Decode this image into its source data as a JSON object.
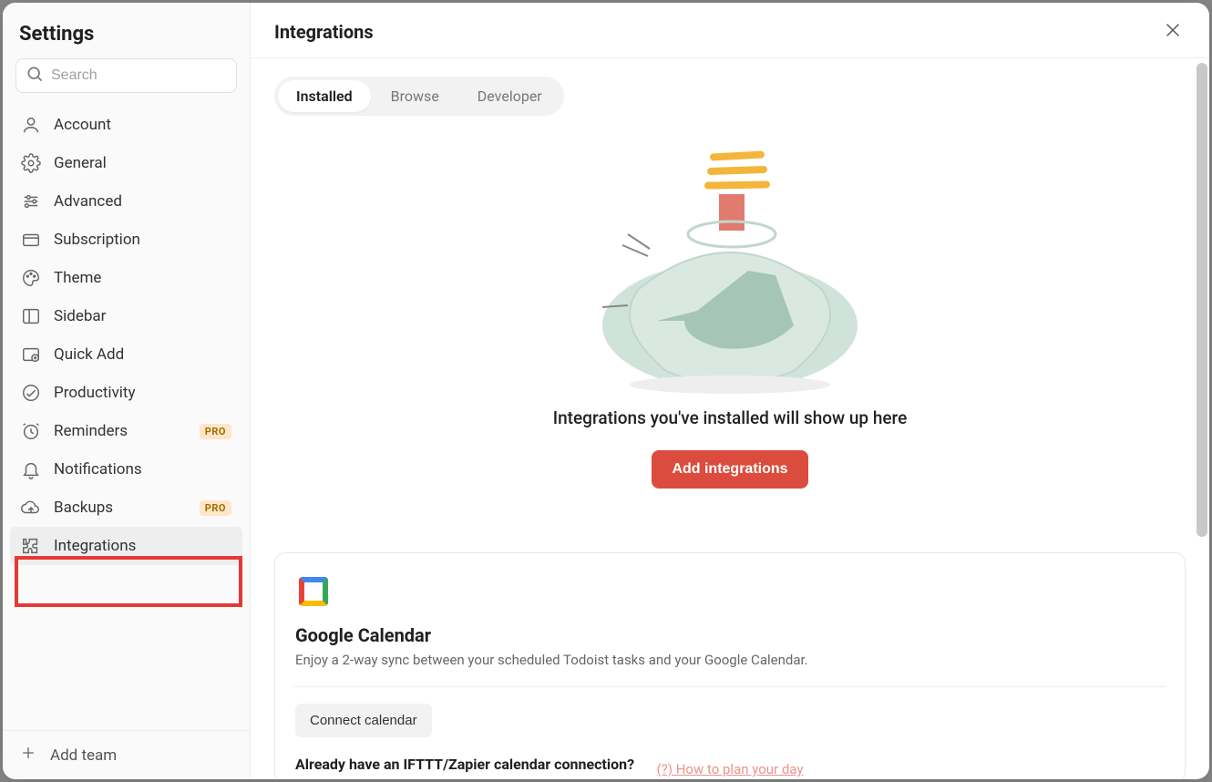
{
  "sidebar": {
    "title": "Settings",
    "search_placeholder": "Search",
    "items": [
      {
        "label": "Account",
        "badge": null
      },
      {
        "label": "General",
        "badge": null
      },
      {
        "label": "Advanced",
        "badge": null
      },
      {
        "label": "Subscription",
        "badge": null
      },
      {
        "label": "Theme",
        "badge": null
      },
      {
        "label": "Sidebar",
        "badge": null
      },
      {
        "label": "Quick Add",
        "badge": null
      },
      {
        "label": "Productivity",
        "badge": null
      },
      {
        "label": "Reminders",
        "badge": "PRO"
      },
      {
        "label": "Notifications",
        "badge": null
      },
      {
        "label": "Backups",
        "badge": "PRO"
      },
      {
        "label": "Integrations",
        "badge": null
      }
    ],
    "footer_label": "Add team"
  },
  "main": {
    "title": "Integrations",
    "tabs": [
      {
        "label": "Installed",
        "active": true
      },
      {
        "label": "Browse",
        "active": false
      },
      {
        "label": "Developer",
        "active": false
      }
    ],
    "empty_text": "Integrations you've installed will show up here",
    "primary_button": "Add integrations",
    "gcal": {
      "title": "Google Calendar",
      "desc": "Enjoy a 2-way sync between your scheduled Todoist tasks and your Google Calendar.",
      "connect_label": "Connect calendar",
      "question": "Already have an IFTTT/Zapier calendar connection?"
    }
  },
  "footer_hint": "(?) How to plan your day"
}
